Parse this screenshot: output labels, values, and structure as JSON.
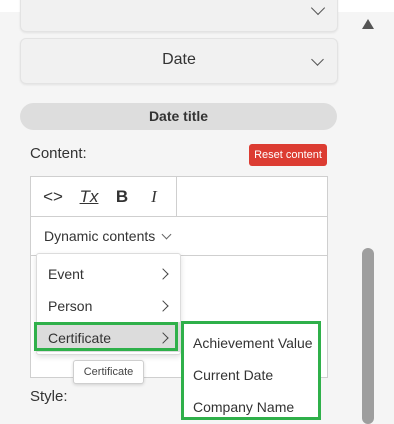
{
  "panel": {
    "date_dropdown_label": "Date",
    "section_title": "Date title",
    "content_label": "Content:",
    "reset_button": "Reset content",
    "style_label": "Style:"
  },
  "editor": {
    "toolbar": {
      "code": "<>",
      "clear_format": "Tx",
      "bold": "B",
      "italic": "I"
    },
    "dynamic_label": "Dynamic contents"
  },
  "menu": {
    "items": [
      {
        "label": "Event"
      },
      {
        "label": "Person"
      },
      {
        "label": "Certificate"
      }
    ],
    "tooltip": "Certificate"
  },
  "submenu": {
    "items": [
      {
        "label": "Achievement Value"
      },
      {
        "label": "Current Date"
      },
      {
        "label": "Company Name"
      }
    ]
  },
  "colors": {
    "reset_button": "#dc3c32",
    "highlight": "#2fb04a"
  },
  "icons": [
    "code-icon",
    "clear-format-icon",
    "bold-icon",
    "italic-icon",
    "chevron-down-icon",
    "chevron-right-icon",
    "scroll-up-icon"
  ]
}
